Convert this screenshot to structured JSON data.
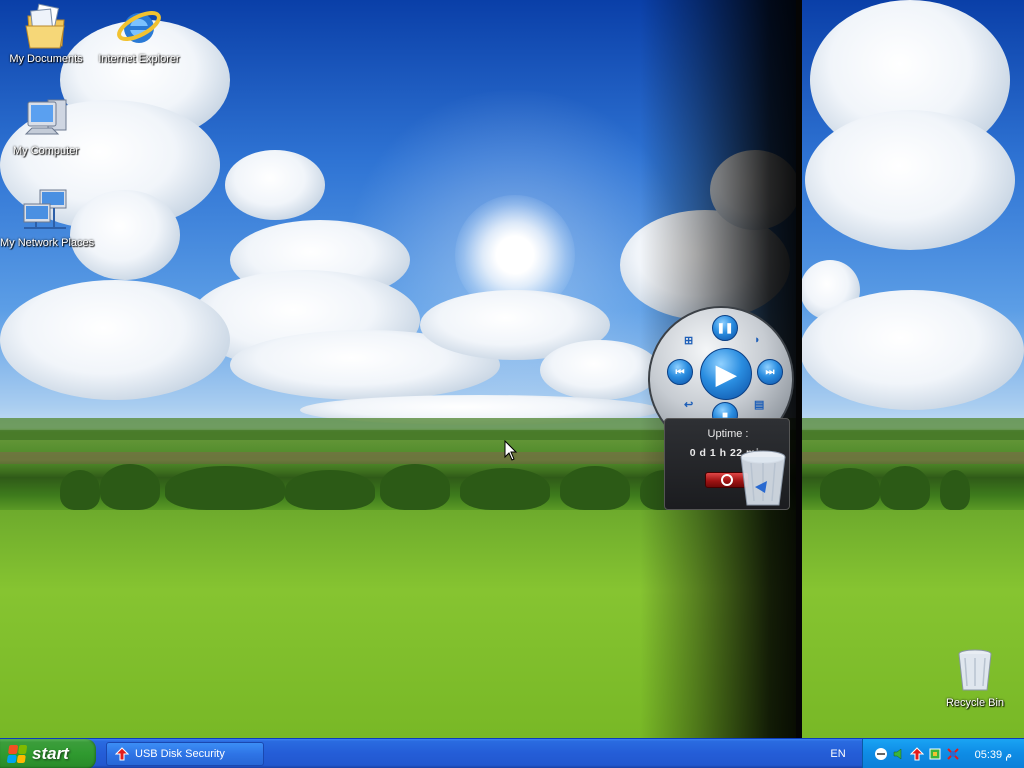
{
  "desktop": {
    "icons": [
      {
        "label": "My Documents",
        "icon": "folder-documents-icon"
      },
      {
        "label": "Internet Explorer",
        "icon": "internet-explorer-icon"
      },
      {
        "label": "My Computer",
        "icon": "computer-icon"
      },
      {
        "label": "My Network Places",
        "icon": "network-places-icon"
      },
      {
        "label": "Recycle Bin",
        "icon": "recycle-bin-icon"
      }
    ]
  },
  "media_widget": {
    "buttons": [
      "pause",
      "previous",
      "play",
      "next",
      "stop",
      "volume",
      "windows",
      "repeat",
      "playlist"
    ]
  },
  "uptime_gadget": {
    "title": "Uptime :",
    "value": "0 d 1 h 22 min",
    "power_icon": "power-icon"
  },
  "taskbar": {
    "start_label": "start",
    "tasks": [
      {
        "label": "USB Disk Security",
        "icon": "usb-disk-security-icon"
      }
    ],
    "language": "EN",
    "tray_icons": [
      "network-icon",
      "volume-icon",
      "usb-disk-security-icon",
      "hardware-icon",
      "connection-icon"
    ],
    "clock": "05:39 م"
  },
  "colors": {
    "taskbar_blue": "#245dd7",
    "start_green": "#2f9a2f",
    "tray_blue": "#0f8de6"
  }
}
